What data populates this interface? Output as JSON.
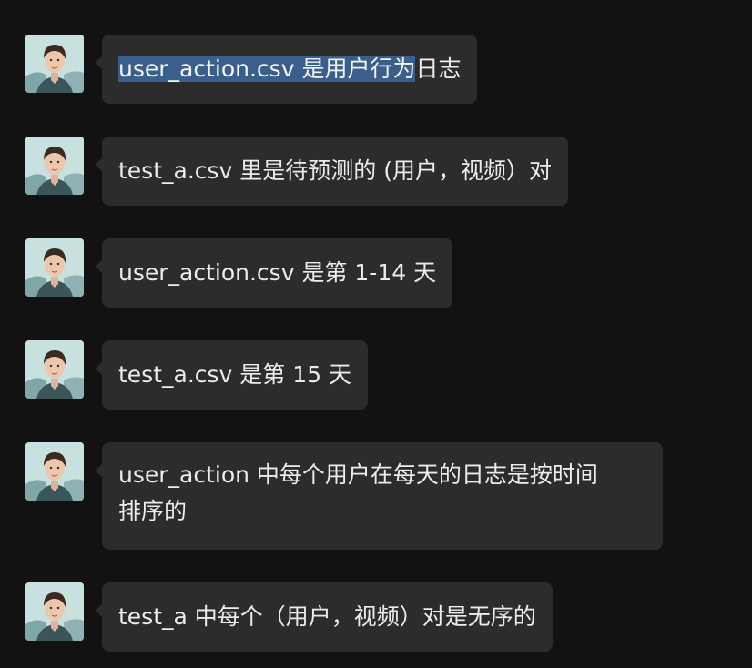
{
  "messages": [
    {
      "highlighted": "user_action.csv 是用户行为",
      "text": "日志"
    },
    {
      "text": "test_a.csv 里是待预测的 (用户，视频）对"
    },
    {
      "text": "user_action.csv 是第 1-14 天"
    },
    {
      "text": "test_a.csv 是第 15 天"
    },
    {
      "line1": "user_action 中每个用户在每天的日志是按时间",
      "line2": "排序的"
    },
    {
      "text": "test_a 中每个（用户，视频）对是无序的"
    }
  ],
  "colors": {
    "background": "#121212",
    "bubble": "#2c2c2c",
    "selection": "#3b5f8d",
    "text": "#ececec"
  },
  "icons": {
    "avatar": "user-avatar-icon"
  }
}
